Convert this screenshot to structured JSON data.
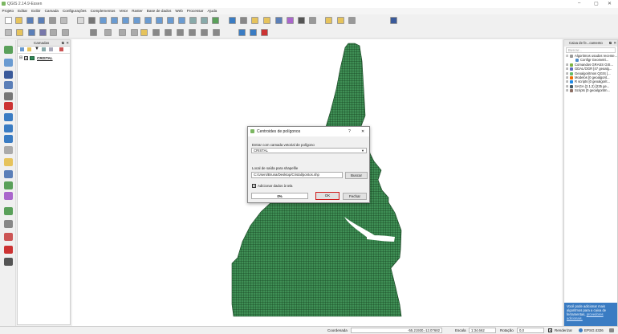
{
  "app": {
    "title": "QGIS 2.14.9-Essen"
  },
  "menu": [
    "Projeto",
    "Editar",
    "Exibir",
    "Camada",
    "Configurações",
    "Complementos",
    "Vetor",
    "Raster",
    "Base de dados",
    "Web",
    "Processar",
    "Ajuda"
  ],
  "layers_panel": {
    "title": "Camadas",
    "layer_name": "CRISTAL",
    "layer_color": "#2e8b57"
  },
  "toolbox": {
    "title": "Caixa de fe...camento",
    "search_placeholder": "Buscar...",
    "items": [
      {
        "label": "Algoritmos usados recente...",
        "expand": "⊟",
        "color": "#999999",
        "child": false
      },
      {
        "label": "Configr Geometri...",
        "expand": "",
        "color": "#4a8ac9",
        "child": true
      },
      {
        "label": "Comandos GRASS GIS...",
        "expand": "⊞",
        "color": "#7cb342",
        "child": false
      },
      {
        "label": "GDAL/OGR [47 geoalg...",
        "expand": "⊞",
        "color": "#5c6bc0",
        "child": false
      },
      {
        "label": "Geoalgoritmos QGIS [...",
        "expand": "⊞",
        "color": "#66bb6a",
        "child": false
      },
      {
        "label": "Modelos [0 geoalgorit...",
        "expand": "⊞",
        "color": "#ef6c00",
        "child": false
      },
      {
        "label": "R scripts [0 geoalgorit...",
        "expand": "⊞",
        "color": "#1e88e5",
        "child": false
      },
      {
        "label": "SAGA (2.1.2) [235 ge...",
        "expand": "⊞",
        "color": "#455a64",
        "child": false
      },
      {
        "label": "Scripts [0 geoalgoritm...",
        "expand": "⊞",
        "color": "#8d6e63",
        "child": false
      }
    ],
    "tip_text": "Você pode adicionar mais algoritmos para a caixa de ferramentas,",
    "tip_link": "provedores adicionais."
  },
  "dialog": {
    "title": "Centroides de polígonos",
    "help": "?",
    "close": "✕",
    "input_label": "Entrar com camada vetorial de polígono",
    "input_value": "CRISTAL",
    "output_label": "Local de saída para shapefile",
    "output_value": "C:/Users/Bruna/Desktop/Cristal/pontos.shp",
    "browse_label": "Buscar",
    "add_checkbox_label": "Adicionar dados à tela",
    "add_checked": true,
    "progress_text": "0%",
    "progress": 0,
    "ok_label": "OK",
    "close_label": "Fechar"
  },
  "statusbar": {
    "coord_label": "Coordenada",
    "coord_value": "-55.21930,-12.07682",
    "scale_label": "Escala",
    "scale_value": "1:34.662",
    "rotation_label": "Rotação",
    "rotation_value": "0,0",
    "render_label": "Renderizar",
    "epsg": "EPSG:4326"
  },
  "colors": {
    "polygon_fill": "#3f8f55",
    "polygon_grid": "#15401f",
    "accent": "#3a7cc3",
    "ok_border": "#d11a1a"
  }
}
